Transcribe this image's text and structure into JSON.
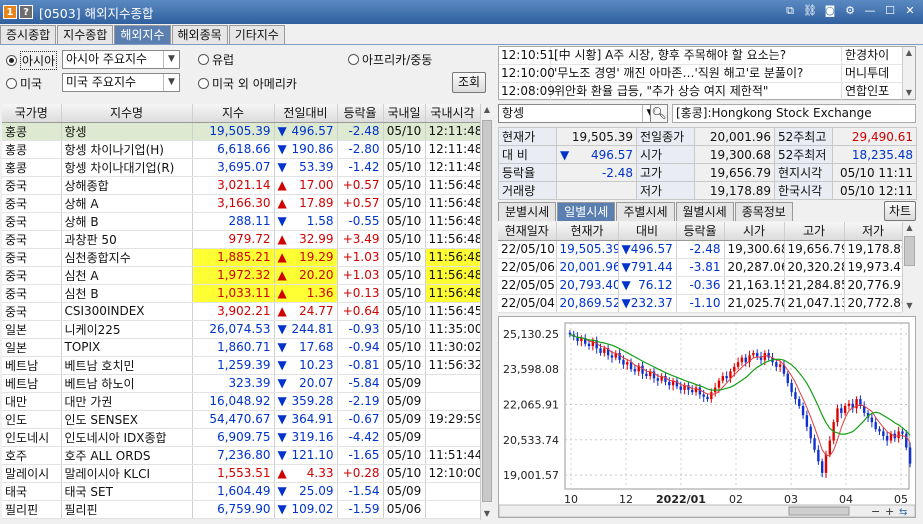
{
  "window": {
    "badge1": "1",
    "badge2": "?",
    "title": "[0503] 해외지수종합",
    "icons": [
      "new-window-icon",
      "link-icon",
      "camera-icon",
      "gear-icon",
      "minimize-icon",
      "maximize-icon",
      "close-icon"
    ]
  },
  "tabs": [
    "증시종합",
    "지수종합",
    "해외지수",
    "해외종목",
    "기타지수"
  ],
  "active_tab": 2,
  "filters": {
    "asia_label": "아시아",
    "asia_select": "아시아 주요지수",
    "europe_label": "유럽",
    "africa_label": "아프리카/중동",
    "us_label": "미국",
    "us_select": "미국 주요지수",
    "us_other_label": "미국 외 아메리카",
    "search_button": "조회"
  },
  "table": {
    "headers": [
      "국가명",
      "지수명",
      "지수",
      "전일대비",
      "등락율",
      "국내일",
      "국내시각"
    ],
    "rows": [
      {
        "country": "홍콩",
        "name": "항셍",
        "value": "19,505.39",
        "dir": "dn",
        "chg": "496.57",
        "rate": "-2.48",
        "date": "05/10",
        "time": "12:11:48",
        "hl": false,
        "sel": true
      },
      {
        "country": "홍콩",
        "name": "항셍 차이나기업(H)",
        "value": "6,618.66",
        "dir": "dn",
        "chg": "190.86",
        "rate": "-2.80",
        "date": "05/10",
        "time": "12:11:48",
        "hl": false,
        "sel": false
      },
      {
        "country": "홍콩",
        "name": "항셍 차이나대기업(R)",
        "value": "3,695.07",
        "dir": "dn",
        "chg": "53.39",
        "rate": "-1.42",
        "date": "05/10",
        "time": "12:11:48",
        "hl": false,
        "sel": false
      },
      {
        "country": "중국",
        "name": "상해종합",
        "value": "3,021.14",
        "dir": "up",
        "chg": "17.00",
        "rate": "+0.57",
        "date": "05/10",
        "time": "11:56:48",
        "hl": false,
        "sel": false
      },
      {
        "country": "중국",
        "name": "상해 A",
        "value": "3,166.30",
        "dir": "up",
        "chg": "17.89",
        "rate": "+0.57",
        "date": "05/10",
        "time": "11:56:48",
        "hl": false,
        "sel": false
      },
      {
        "country": "중국",
        "name": "상해 B",
        "value": "288.11",
        "dir": "dn",
        "chg": "1.58",
        "rate": "-0.55",
        "date": "05/10",
        "time": "11:56:48",
        "hl": false,
        "sel": false
      },
      {
        "country": "중국",
        "name": "과창판 50",
        "value": "979.72",
        "dir": "up",
        "chg": "32.99",
        "rate": "+3.49",
        "date": "05/10",
        "time": "11:56:48",
        "hl": false,
        "sel": false
      },
      {
        "country": "중국",
        "name": "심천종합지수",
        "value": "1,885.21",
        "dir": "up",
        "chg": "19.29",
        "rate": "+1.03",
        "date": "05/10",
        "time": "11:56:48",
        "hl": true,
        "sel": false
      },
      {
        "country": "중국",
        "name": "심천 A",
        "value": "1,972.32",
        "dir": "up",
        "chg": "20.20",
        "rate": "+1.03",
        "date": "05/10",
        "time": "11:56:48",
        "hl": true,
        "sel": false
      },
      {
        "country": "중국",
        "name": "심천 B",
        "value": "1,033.11",
        "dir": "up",
        "chg": "1.36",
        "rate": "+0.13",
        "date": "05/10",
        "time": "11:56:48",
        "hl": true,
        "sel": false
      },
      {
        "country": "중국",
        "name": "CSI300INDEX",
        "value": "3,902.21",
        "dir": "up",
        "chg": "24.77",
        "rate": "+0.64",
        "date": "05/10",
        "time": "11:56:45",
        "hl": false,
        "sel": false
      },
      {
        "country": "일본",
        "name": "니케이225",
        "value": "26,074.53",
        "dir": "dn",
        "chg": "244.81",
        "rate": "-0.93",
        "date": "05/10",
        "time": "11:35:00",
        "hl": false,
        "sel": false
      },
      {
        "country": "일본",
        "name": "TOPIX",
        "value": "1,860.71",
        "dir": "dn",
        "chg": "17.68",
        "rate": "-0.94",
        "date": "05/10",
        "time": "11:30:02",
        "hl": false,
        "sel": false
      },
      {
        "country": "베트남",
        "name": "베트남 호치민",
        "value": "1,259.39",
        "dir": "dn",
        "chg": "10.23",
        "rate": "-0.81",
        "date": "05/10",
        "time": "11:56:32",
        "hl": false,
        "sel": false
      },
      {
        "country": "베트남",
        "name": "베트남 하노이",
        "value": "323.39",
        "dir": "dn",
        "chg": "20.07",
        "rate": "-5.84",
        "date": "05/09",
        "time": "",
        "hl": false,
        "sel": false
      },
      {
        "country": "대만",
        "name": "대만 가권",
        "value": "16,048.92",
        "dir": "dn",
        "chg": "359.28",
        "rate": "-2.19",
        "date": "05/09",
        "time": "",
        "hl": false,
        "sel": false
      },
      {
        "country": "인도",
        "name": "인도 SENSEX",
        "value": "54,470.67",
        "dir": "dn",
        "chg": "364.91",
        "rate": "-0.67",
        "date": "05/09",
        "time": "19:29:59",
        "hl": false,
        "sel": false
      },
      {
        "country": "인도네시",
        "name": "인도네시아 IDX종합",
        "value": "6,909.75",
        "dir": "dn",
        "chg": "319.16",
        "rate": "-4.42",
        "date": "05/09",
        "time": "",
        "hl": false,
        "sel": false
      },
      {
        "country": "호주",
        "name": "호주 ALL ORDS",
        "value": "7,236.80",
        "dir": "dn",
        "chg": "121.10",
        "rate": "-1.65",
        "date": "05/10",
        "time": "11:51:44",
        "hl": false,
        "sel": false
      },
      {
        "country": "말레이시",
        "name": "말레이시아 KLCI",
        "value": "1,553.51",
        "dir": "up",
        "chg": "4.33",
        "rate": "+0.28",
        "date": "05/10",
        "time": "12:10:00",
        "hl": false,
        "sel": false
      },
      {
        "country": "태국",
        "name": "태국 SET",
        "value": "1,604.49",
        "dir": "dn",
        "chg": "25.09",
        "rate": "-1.54",
        "date": "05/09",
        "time": "",
        "hl": false,
        "sel": false
      },
      {
        "country": "필리핀",
        "name": "필리핀",
        "value": "6,759.90",
        "dir": "dn",
        "chg": "109.02",
        "rate": "-1.59",
        "date": "05/06",
        "time": "",
        "hl": false,
        "sel": false
      }
    ]
  },
  "news": [
    {
      "time": "12:10:51",
      "headline": "[中 시황] A주 시장, 향후 주목해야 할 요소는?",
      "source": "한경차이"
    },
    {
      "time": "12:10:00",
      "headline": "'무노조 경영' 깨진 아마존…'직원 해고'로 분풀이?",
      "source": "머니투데"
    },
    {
      "time": "12:08:09",
      "headline": "위안화 환율 급등, \"추가 상승 여지 제한적\"",
      "source": "연합인포"
    }
  ],
  "symbol": {
    "search_value": "항셍",
    "exchange": "[홍콩]:Hongkong Stock Exchange"
  },
  "quote": {
    "current_label": "현재가",
    "current": "19,505.39",
    "prev_label": "전일종가",
    "prev": "20,001.96",
    "high52_label": "52주최고",
    "high52": "29,490.61",
    "vs_label": "대 비",
    "vs": "496.57",
    "open_label": "시가",
    "open": "19,300.68",
    "low52_label": "52주최저",
    "low52": "18,235.48",
    "rate_label": "등락율",
    "rate": "-2.48",
    "high_label": "고가",
    "high": "19,656.79",
    "local_time_label": "현지시각",
    "local_time": "05/10 11:11",
    "volume_label": "거래량",
    "volume": "",
    "low_label": "저가",
    "low": "19,178.89",
    "kr_time_label": "한국시각",
    "kr_time": "05/10 12:11"
  },
  "subtabs": [
    "분별시세",
    "일별시세",
    "주별시세",
    "월별시세",
    "종목정보"
  ],
  "active_subtab": 1,
  "chart_button": "차트",
  "daily": {
    "headers": [
      "현재일자",
      "현재가",
      "대비",
      "등락율",
      "시가",
      "고가",
      "저가"
    ],
    "rows": [
      {
        "date": "22/05/10",
        "price": "19,505.39",
        "chg": "496.57",
        "rate": "-2.48",
        "open": "19,300.68",
        "high": "19,656.79",
        "low": "19,178.89"
      },
      {
        "date": "22/05/06",
        "price": "20,001.96",
        "chg": "791.44",
        "rate": "-3.81",
        "open": "20,287.06",
        "high": "20,320.28",
        "low": "19,973.47"
      },
      {
        "date": "22/05/05",
        "price": "20,793.40",
        "chg": "76.12",
        "rate": "-0.36",
        "open": "21,163.15",
        "high": "21,284.85",
        "low": "20,776.97"
      },
      {
        "date": "22/05/04",
        "price": "20,869.52",
        "chg": "232.37",
        "rate": "-1.10",
        "open": "21,025.70",
        "high": "21,047.13",
        "low": "20,772.80"
      }
    ]
  },
  "chart_data": {
    "type": "candlestick",
    "y_ticks": [
      "25,130.25",
      "23,598.08",
      "22,065.91",
      "20,533.74",
      "19,001.57"
    ],
    "y_tick_values": [
      25130.25,
      23598.08,
      22065.91,
      20533.74,
      19001.57
    ],
    "x_ticks": [
      "10",
      "12",
      "2022/01",
      "02",
      "03",
      "04",
      "05"
    ],
    "ylim": [
      18400,
      25600
    ],
    "closes": [
      25100,
      25000,
      24820,
      24950,
      24700,
      24600,
      24850,
      24500,
      24300,
      24500,
      24200,
      24100,
      24300,
      24000,
      23800,
      23900,
      23600,
      23500,
      23750,
      23400,
      23300,
      23500,
      23200,
      23100,
      23300,
      23050,
      22900,
      23100,
      22850,
      22700,
      22900,
      22700,
      22600,
      22800,
      22500,
      22400,
      22300,
      22600,
      22800,
      23100,
      23300,
      23200,
      23500,
      23700,
      23900,
      24100,
      23900,
      24200,
      24300,
      24150,
      24000,
      24300,
      24100,
      23900,
      23700,
      23800,
      23400,
      23000,
      22600,
      22300,
      22000,
      21600,
      21100,
      20600,
      20100,
      19600,
      19100,
      19900,
      20500,
      21300,
      21900,
      21700,
      22000,
      22100,
      21900,
      22300,
      22000,
      21700,
      21500,
      21300,
      21000,
      20900,
      20700,
      20500,
      20800,
      20600,
      20900,
      20800,
      20200,
      19500
    ]
  }
}
